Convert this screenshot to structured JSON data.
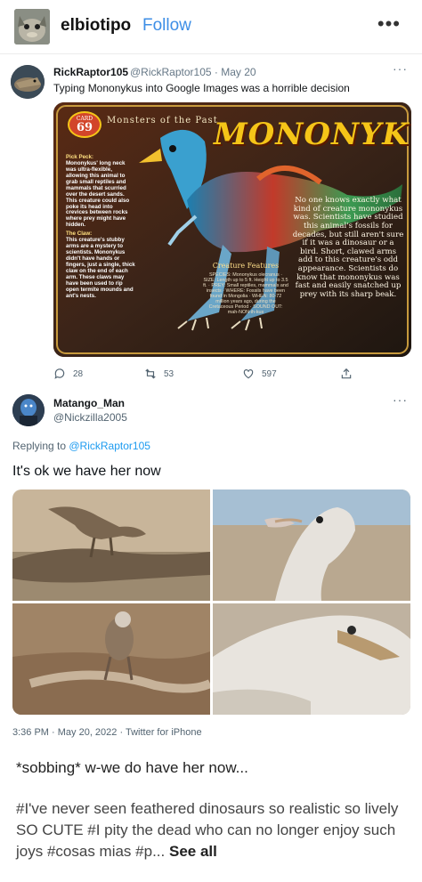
{
  "post": {
    "username": "elbiotipo",
    "follow_label": "Follow",
    "menu_icon": "more-horizontal-icon",
    "caption": "*sobbing* w-we do have her now...",
    "tags": "#I've never seen feathered dinosaurs so realistic so lively SO CUTE  #I pity the dead who can no longer enjoy such joys  #cosas mias  #p...",
    "see_all_label": "See all"
  },
  "tweet1": {
    "name": "RickRaptor105",
    "handle": "@RickRaptor105 · May 20",
    "text": "Typing Mononykus into Google Images was a horrible decision",
    "more": "···",
    "card": {
      "number_label": "CARD",
      "number": "69",
      "series": "Monsters of the Past",
      "title": "MONONYKUS",
      "pick_peck_title": "Pick Peck:",
      "pick_peck": "Mononykus' long neck was ultra-flexible, allowing this animal to grab small reptiles and mammals that scurried over the desert sands. This creature could also poke its head into crevices between rocks where prey might have hidden.",
      "claw_title": "The Claw:",
      "claw": "This creature's stubby arms are a mystery to scientists. Mononykus didn't have hands or fingers, just a single, thick claw on the end of each arm. These claws may have been used to rip open termite mounds and ant's nests.",
      "right_text": "No one knows exactly what kind of creature mononykus was. Scientists have studied this animal's fossils for decades, but still aren't sure if it was a dinosaur or a bird. Short, clawed arms add to this creature's odd appearance. Scientists do know that mononykus was fast and easily snatched up prey with its sharp beak.",
      "features_title": "Creature Features",
      "features": "SPECIES: Mononykus olecranus · SIZE: Length up to 5 ft. Height up to 3.5 ft. · PREY: Small reptiles, mammals and insects · WHERE: Fossils have been found in Mongolia · WHEN: 80-72 million years ago, during the Cretaceous Period · SOUND OUT: mah-NON-ih-kus"
    },
    "replies": "28",
    "retweets": "53",
    "likes": "597"
  },
  "tweet2": {
    "name": "Matango_Man",
    "handle": "@Nickzilla2005",
    "replying_prefix": "Replying to ",
    "replying_to": "@RickRaptor105",
    "text": "It's ok we have her now",
    "meta": "3:36 PM · May 20, 2022 · Twitter for iPhone",
    "more": "···"
  }
}
